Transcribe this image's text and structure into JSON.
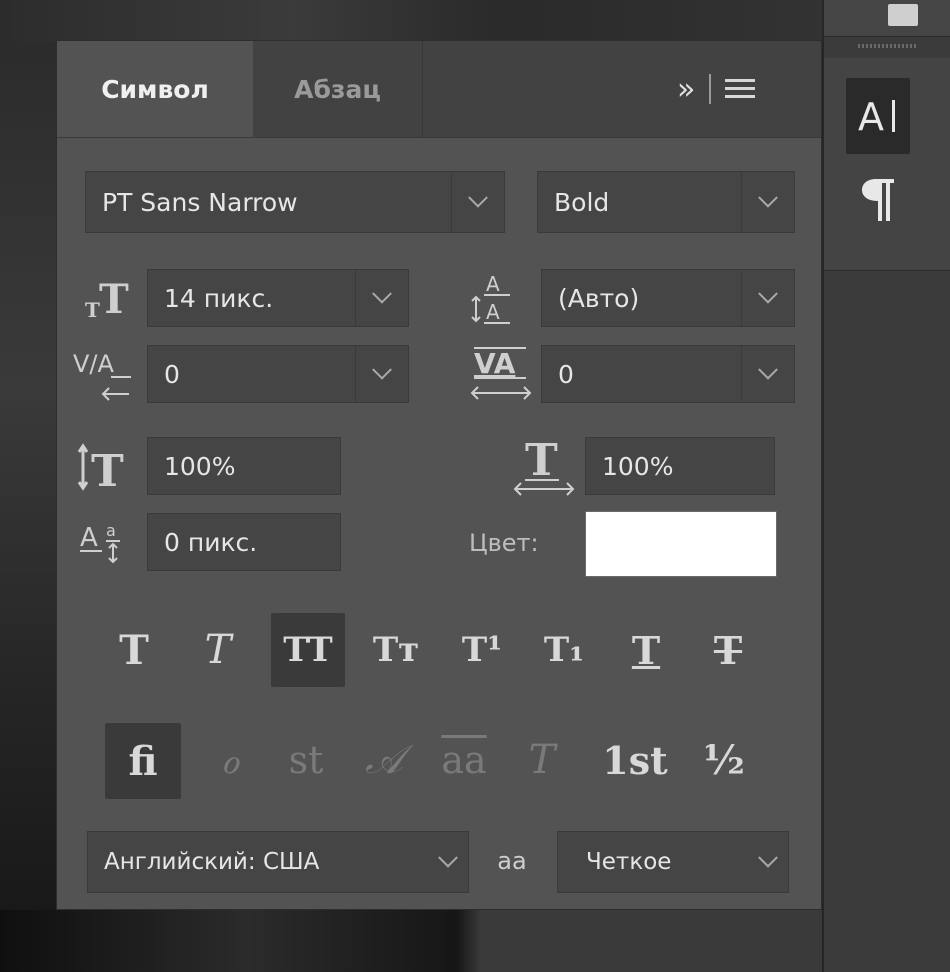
{
  "tabs": [
    {
      "label": "Символ",
      "active": true
    },
    {
      "label": "Абзац",
      "active": false
    }
  ],
  "panel_icons": {
    "expand": "»",
    "menu": "≡"
  },
  "font": {
    "family": "PT Sans Narrow",
    "style": "Bold"
  },
  "size": {
    "value": "14 пикс."
  },
  "leading": {
    "value": "(Авто)"
  },
  "kerning": {
    "value": "0"
  },
  "tracking": {
    "value": "0"
  },
  "vertical_scale": {
    "value": "100%"
  },
  "horizontal_scale": {
    "value": "100%"
  },
  "baseline_shift": {
    "value": "0 пикс."
  },
  "color": {
    "label": "Цвет:",
    "swatch": "#ffffff"
  },
  "language": {
    "value": "Английский: США"
  },
  "antialias": {
    "icon": "aa",
    "value": "Четкое"
  },
  "style_buttons": [
    {
      "name": "faux-bold",
      "glyph": "T"
    },
    {
      "name": "faux-italic",
      "glyph": "T"
    },
    {
      "name": "all-caps",
      "glyph": "TT",
      "active": true
    },
    {
      "name": "small-caps",
      "glyph": "Tт"
    },
    {
      "name": "superscript",
      "glyph": "T¹"
    },
    {
      "name": "subscript",
      "glyph": "T₁"
    },
    {
      "name": "underline",
      "glyph": "T"
    },
    {
      "name": "strikethrough",
      "glyph": "T"
    }
  ],
  "opentype_buttons": [
    {
      "name": "ligatures",
      "glyph": "fi",
      "active": true
    },
    {
      "name": "discretionary-ligatures",
      "glyph": "ℴ"
    },
    {
      "name": "contextual-alternates",
      "glyph": "st"
    },
    {
      "name": "swash",
      "glyph": "𝒜"
    },
    {
      "name": "stylistic-alternates",
      "glyph": "aa"
    },
    {
      "name": "titling-alternates",
      "glyph": "T"
    },
    {
      "name": "ordinals",
      "glyph": "1st"
    },
    {
      "name": "fractions",
      "glyph": "½"
    }
  ]
}
